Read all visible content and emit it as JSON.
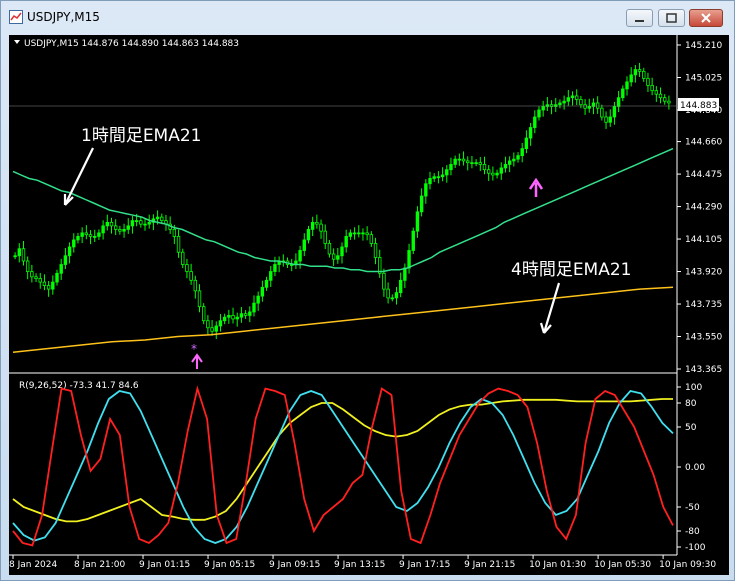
{
  "window": {
    "title": "USDJPY,M15",
    "buttons": {
      "minimize_icon": "minimize-icon",
      "maximize_icon": "maximize-icon",
      "close_icon": "close-icon"
    }
  },
  "colors": {
    "background": "#000000",
    "bull_candle": "#00ff00",
    "ema_1h": "#33e08a",
    "ema_4h": "#ffc21a",
    "r_fast": "#ff2020",
    "r_mid": "#40e0f0",
    "r_slow": "#f0f020",
    "signal_arrow": "#ff66ff",
    "price_label_bg": "#ffffff"
  },
  "chart": {
    "header": "USDJPY,M15  144.876 144.890 144.863 144.883",
    "current_price": "144.883",
    "price_axis": [
      "145.210",
      "145.025",
      "144.840",
      "144.660",
      "144.475",
      "144.290",
      "144.105",
      "143.920",
      "143.735",
      "143.550",
      "143.365"
    ],
    "time_axis": [
      "8 Jan 2024",
      "8 Jan 21:00",
      "9 Jan 01:15",
      "9 Jan 05:15",
      "9 Jan 09:15",
      "9 Jan 13:15",
      "9 Jan 17:15",
      "9 Jan 21:15",
      "10 Jan 01:30",
      "10 Jan 05:30",
      "10 Jan 09:30"
    ],
    "annotations": {
      "ema_1h": "1時間足EMA21",
      "ema_4h": "4時間足EMA21"
    }
  },
  "indicator": {
    "header": "R(9,26,52) -73.3 41.7 84.6",
    "axis": [
      "100",
      "80",
      "50",
      "0.00",
      "-50",
      "-80",
      "-100"
    ]
  },
  "chart_data": {
    "type": "line",
    "title": "USDJPY,M15",
    "price_range": [
      143.365,
      145.21
    ],
    "close": [
      144.01,
      144.05,
      143.98,
      143.92,
      143.89,
      143.88,
      143.86,
      143.84,
      143.82,
      143.86,
      143.91,
      143.96,
      144.01,
      144.06,
      144.1,
      144.12,
      144.14,
      144.13,
      144.12,
      144.12,
      144.14,
      144.18,
      144.2,
      144.18,
      144.16,
      144.15,
      144.16,
      144.18,
      144.21,
      144.21,
      144.19,
      144.19,
      144.2,
      144.22,
      144.23,
      144.21,
      144.19,
      144.16,
      144.12,
      144.03,
      143.96,
      143.92,
      143.87,
      143.81,
      143.72,
      143.64,
      143.6,
      143.58,
      143.61,
      143.64,
      143.66,
      143.67,
      143.65,
      143.66,
      143.68,
      143.67,
      143.69,
      143.74,
      143.78,
      143.83,
      143.87,
      143.92,
      143.96,
      143.98,
      143.98,
      143.96,
      143.96,
      143.98,
      144.04,
      144.1,
      144.16,
      144.2,
      144.19,
      144.15,
      144.08,
      144.02,
      143.99,
      144.01,
      144.06,
      144.12,
      144.14,
      144.14,
      144.14,
      144.14,
      144.13,
      144.08,
      144.0,
      143.91,
      143.82,
      143.77,
      143.77,
      143.8,
      143.87,
      143.94,
      144.04,
      144.15,
      144.26,
      144.35,
      144.42,
      144.45,
      144.46,
      144.46,
      144.47,
      144.5,
      144.53,
      144.56,
      144.56,
      144.55,
      144.54,
      144.54,
      144.54,
      144.53,
      144.5,
      144.48,
      144.47,
      144.48,
      144.51,
      144.53,
      144.55,
      144.56,
      144.58,
      144.62,
      144.68,
      144.74,
      144.8,
      144.84,
      144.86,
      144.87,
      144.86,
      144.87,
      144.88,
      144.89,
      144.91,
      144.92,
      144.9,
      144.87,
      144.85,
      144.86,
      144.88,
      144.85,
      144.8,
      144.77,
      144.8,
      144.86,
      144.91,
      144.96,
      145.0,
      145.04,
      145.07,
      145.06,
      145.02,
      144.98,
      144.95,
      144.93,
      144.91,
      144.89,
      144.88
    ],
    "ema_1h": [
      144.49,
      144.47,
      144.45,
      144.44,
      144.42,
      144.4,
      144.38,
      144.37,
      144.35,
      144.33,
      144.31,
      144.29,
      144.27,
      144.26,
      144.25,
      144.24,
      144.23,
      144.21,
      144.2,
      144.19,
      144.17,
      144.16,
      144.14,
      144.12,
      144.1,
      144.09,
      144.07,
      144.05,
      144.03,
      144.02,
      144.0,
      143.99,
      143.98,
      143.98,
      143.97,
      143.96,
      143.96,
      143.95,
      143.95,
      143.95,
      143.94,
      143.94,
      143.93,
      143.93,
      143.92,
      143.92,
      143.92,
      143.93,
      143.93,
      143.94,
      143.96,
      143.98,
      144.0,
      144.03,
      144.05,
      144.07,
      144.09,
      144.11,
      144.13,
      144.15,
      144.17,
      144.2,
      144.22,
      144.24,
      144.26,
      144.28,
      144.3,
      144.32,
      144.34,
      144.36,
      144.38,
      144.4,
      144.42,
      144.44,
      144.46,
      144.48,
      144.5,
      144.52,
      144.54,
      144.56,
      144.58,
      144.6,
      144.62
    ],
    "ema_4h": [
      143.46,
      143.48,
      143.5,
      143.52,
      143.53,
      143.55,
      143.56,
      143.58,
      143.6,
      143.62,
      143.64,
      143.66,
      143.68,
      143.7,
      143.72,
      143.74,
      143.76,
      143.78,
      143.8,
      143.82,
      143.83
    ],
    "r_fast": [
      -80,
      -95,
      -98,
      -60,
      20,
      98,
      95,
      40,
      -5,
      10,
      60,
      40,
      -50,
      -90,
      -95,
      -85,
      -70,
      -20,
      45,
      98,
      60,
      -60,
      -95,
      -90,
      -20,
      60,
      98,
      95,
      90,
      30,
      -40,
      -80,
      -60,
      -50,
      -40,
      -20,
      -10,
      50,
      98,
      90,
      -30,
      -90,
      -95,
      -60,
      -20,
      10,
      40,
      60,
      80,
      92,
      98,
      95,
      90,
      75,
      30,
      -30,
      -75,
      -90,
      -60,
      30,
      85,
      95,
      90,
      70,
      50,
      20,
      -10,
      -50,
      -73
    ],
    "r_mid": [
      -70,
      -85,
      -92,
      -88,
      -70,
      -40,
      -10,
      20,
      55,
      85,
      95,
      92,
      70,
      40,
      10,
      -20,
      -50,
      -75,
      -90,
      -95,
      -90,
      -75,
      -50,
      -20,
      10,
      40,
      70,
      90,
      95,
      90,
      70,
      50,
      30,
      10,
      -10,
      -30,
      -50,
      -55,
      -45,
      -25,
      0,
      30,
      55,
      75,
      85,
      80,
      65,
      40,
      10,
      -20,
      -45,
      -60,
      -55,
      -40,
      -10,
      20,
      55,
      80,
      95,
      92,
      75,
      55,
      42
    ],
    "r_slow": [
      -40,
      -50,
      -55,
      -60,
      -65,
      -68,
      -68,
      -65,
      -60,
      -55,
      -50,
      -45,
      -40,
      -50,
      -60,
      -62,
      -65,
      -66,
      -66,
      -62,
      -55,
      -40,
      -20,
      0,
      20,
      40,
      55,
      65,
      75,
      80,
      80,
      72,
      62,
      52,
      45,
      40,
      38,
      40,
      45,
      55,
      65,
      72,
      76,
      78,
      78,
      80,
      82,
      83,
      84,
      84,
      84,
      84,
      83,
      82,
      82,
      82,
      82,
      82,
      82,
      83,
      84,
      85,
      85
    ],
    "r_range": [
      -100,
      100
    ],
    "ylim": [
      143.365,
      145.21
    ]
  }
}
